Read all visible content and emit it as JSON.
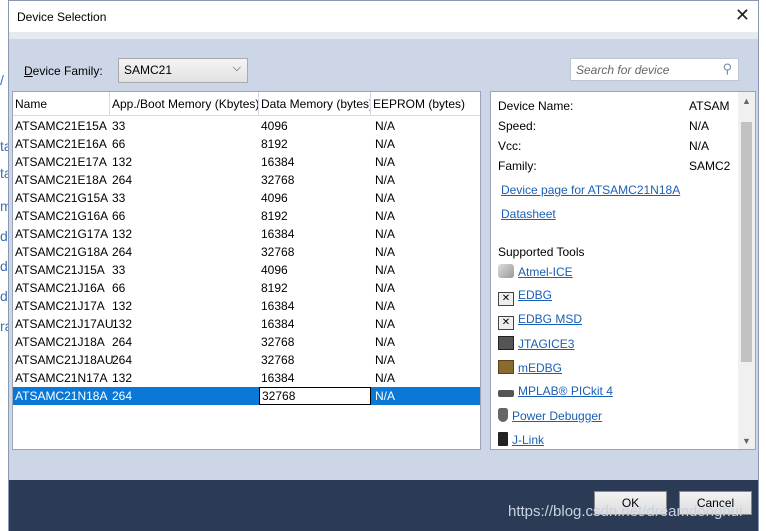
{
  "window": {
    "title": "Device Selection",
    "close_glyph": "✕"
  },
  "background": {
    "glyphs": [
      "/",
      "ta",
      "ta",
      "m",
      "d",
      "d",
      "d",
      "ra"
    ]
  },
  "family": {
    "label_prefix": "D",
    "label_rest": "evice Family:",
    "value": "SAMC21"
  },
  "search": {
    "placeholder": "Search for device"
  },
  "table": {
    "columns": [
      "Name",
      "App./Boot Memory (Kbytes)",
      "Data Memory (bytes)",
      "EEPROM (bytes)"
    ],
    "rows": [
      [
        "ATSAMC21E15A",
        "33",
        "4096",
        "N/A"
      ],
      [
        "ATSAMC21E16A",
        "66",
        "8192",
        "N/A"
      ],
      [
        "ATSAMC21E17A",
        "132",
        "16384",
        "N/A"
      ],
      [
        "ATSAMC21E18A",
        "264",
        "32768",
        "N/A"
      ],
      [
        "ATSAMC21G15A",
        "33",
        "4096",
        "N/A"
      ],
      [
        "ATSAMC21G16A",
        "66",
        "8192",
        "N/A"
      ],
      [
        "ATSAMC21G17A",
        "132",
        "16384",
        "N/A"
      ],
      [
        "ATSAMC21G18A",
        "264",
        "32768",
        "N/A"
      ],
      [
        "ATSAMC21J15A",
        "33",
        "4096",
        "N/A"
      ],
      [
        "ATSAMC21J16A",
        "66",
        "8192",
        "N/A"
      ],
      [
        "ATSAMC21J17A",
        "132",
        "16384",
        "N/A"
      ],
      [
        "ATSAMC21J17AU",
        "132",
        "16384",
        "N/A"
      ],
      [
        "ATSAMC21J18A",
        "264",
        "32768",
        "N/A"
      ],
      [
        "ATSAMC21J18AU",
        "264",
        "32768",
        "N/A"
      ],
      [
        "ATSAMC21N17A",
        "132",
        "16384",
        "N/A"
      ],
      [
        "ATSAMC21N18A",
        "264",
        "32768",
        "N/A"
      ]
    ],
    "selected_row": 15
  },
  "info": {
    "fields": [
      {
        "label": "Device Name:",
        "value": "ATSAM"
      },
      {
        "label": "Speed:",
        "value": "N/A"
      },
      {
        "label": "Vcc:",
        "value": "N/A"
      },
      {
        "label": "Family:",
        "value": "SAMC2"
      }
    ],
    "links": [
      "Device page for ATSAMC21N18A",
      "Datasheet"
    ],
    "tools_heading": "Supported Tools",
    "tools": [
      {
        "name": "Atmel-ICE",
        "icon": "atmel-ice-icon"
      },
      {
        "name": "EDBG",
        "icon": "edbg-icon"
      },
      {
        "name": "EDBG MSD",
        "icon": "edbg-msd-icon"
      },
      {
        "name": "JTAGICE3",
        "icon": "jtagice3-icon"
      },
      {
        "name": "mEDBG",
        "icon": "medbg-icon"
      },
      {
        "name": "MPLAB® PICkit 4",
        "icon": "pickit-icon"
      },
      {
        "name": "Power Debugger",
        "icon": "power-debugger-icon"
      },
      {
        "name": "J-Link",
        "icon": "jlink-icon"
      }
    ]
  },
  "buttons": {
    "ok": "OK",
    "cancel": "Cancel"
  },
  "watermark": "https://blog.csdn.net/dreamdonghui",
  "colors": {
    "selection": "#0a78d7",
    "link": "#1a5fb4",
    "footer": "#2b3a55"
  }
}
